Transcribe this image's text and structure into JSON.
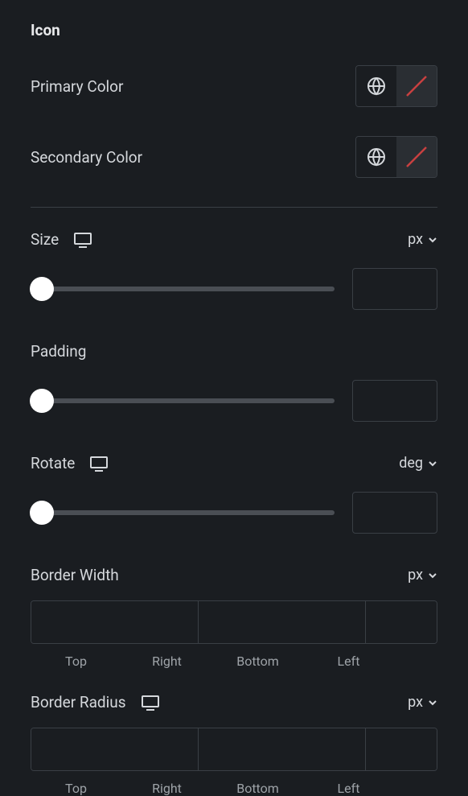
{
  "section": {
    "title": "Icon"
  },
  "primaryColor": {
    "label": "Primary Color"
  },
  "secondaryColor": {
    "label": "Secondary Color"
  },
  "size": {
    "label": "Size",
    "unit": "px",
    "value": ""
  },
  "padding": {
    "label": "Padding",
    "value": ""
  },
  "rotate": {
    "label": "Rotate",
    "unit": "deg",
    "value": ""
  },
  "borderWidth": {
    "label": "Border Width",
    "unit": "px",
    "sides": {
      "top": "Top",
      "right": "Right",
      "bottom": "Bottom",
      "left": "Left"
    }
  },
  "borderRadius": {
    "label": "Border Radius",
    "unit": "px",
    "sides": {
      "top": "Top",
      "right": "Right",
      "bottom": "Bottom",
      "left": "Left"
    }
  }
}
